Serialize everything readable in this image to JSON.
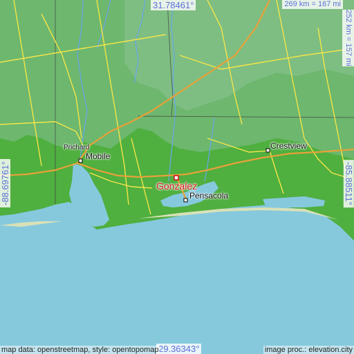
{
  "map": {
    "coordinates": {
      "top": "31.78461°",
      "bottom": "29.36343°",
      "left": "-88.69761°",
      "right": "-85.88511°"
    },
    "scale": {
      "horizontal": "269 km = 167 mi",
      "vertical": "252 km = 157 mi"
    },
    "cities": {
      "prichard": "Prichard",
      "mobile": "Mobile",
      "crestview": "Crestview",
      "pensacola": "Pensacola"
    },
    "marker": {
      "label": "Gonzalez",
      "color": "#d4151b"
    },
    "attribution": {
      "left": "map data: openstreetmap, style: opentopomap",
      "right": "image proc.: elevation.city"
    },
    "colors": {
      "water": "#86c9dd",
      "lowland": "#4faf3f",
      "upland": "#6fb774",
      "major_road": "#e8a13a",
      "minor_road": "#f4e54a",
      "text_accent": "#5b6fd6"
    }
  }
}
